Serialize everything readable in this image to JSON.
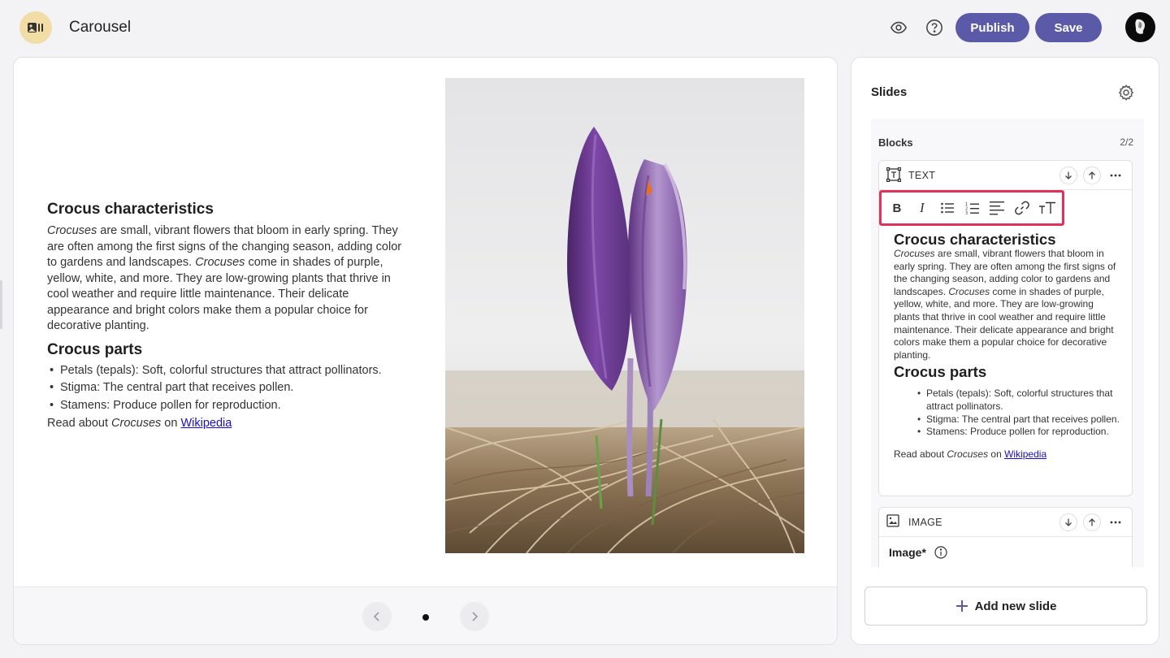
{
  "header": {
    "title": "Carousel",
    "publish_label": "Publish",
    "save_label": "Save",
    "icons": [
      "preview-eye-icon",
      "help-icon",
      "avatar"
    ]
  },
  "preview": {
    "heading1": "Crocus characteristics",
    "para": {
      "em1": "Crocuses",
      "t1": " are small, vibrant flowers that bloom in early spring. They are often among the first signs of the changing season, adding color to gardens and landscapes. ",
      "em2": "Crocuses",
      "t2": " come in shades of purple, yellow, white, and more. They are low-growing plants that thrive in cool weather and require little maintenance. Their delicate appearance and bright colors make them a popular choice for decorative planting."
    },
    "heading2": "Crocus parts",
    "parts": [
      "Petals (tepals): Soft, colorful structures that attract pollinators.",
      "Stigma: The central part that receives pollen.",
      "Stamens: Produce pollen for reproduction."
    ],
    "read": {
      "before": "Read about ",
      "em": "Crocuses",
      "mid": " on ",
      "link": "Wikipedia"
    },
    "image_subject": "purple crocus flowers in dry grass",
    "pagination": {
      "total": 1,
      "current": 1
    }
  },
  "sidebar": {
    "title": "Slides",
    "blocks_label": "Blocks",
    "blocks_count": "2/2",
    "text_block": {
      "label": "TEXT",
      "toolbar": [
        "bold",
        "italic",
        "bulleted-list",
        "numbered-list",
        "align",
        "link",
        "text-size"
      ],
      "toolbar_glyphs": {
        "bold": "B",
        "italic": "I"
      }
    },
    "image_block": {
      "label": "IMAGE",
      "field_label": "Image*"
    },
    "add_slide_label": "Add new slide"
  },
  "colors": {
    "accent": "#5a5aa8",
    "highlight": "#e0335c",
    "logo_bg": "#f1dda5",
    "link": "#1a0dcc"
  }
}
